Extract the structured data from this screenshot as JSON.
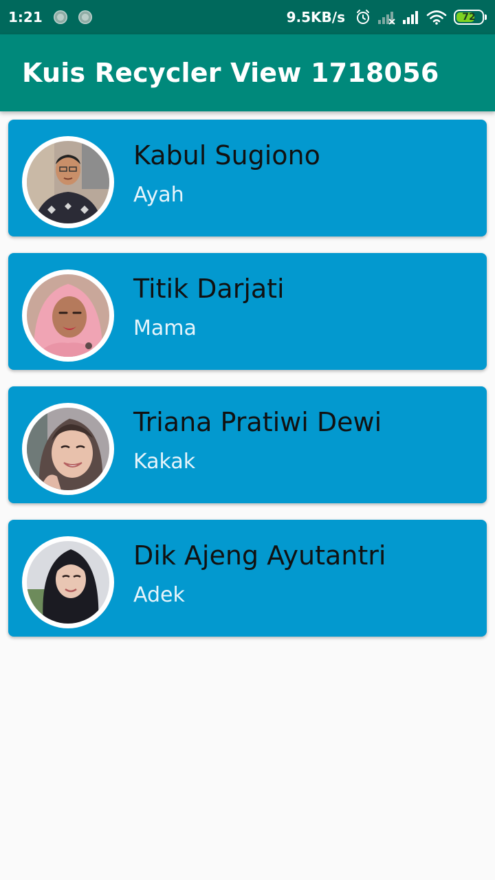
{
  "status_bar": {
    "time": "1:21",
    "net_speed": "9.5KB/s",
    "battery_level": "72",
    "battery_fraction": 0.72,
    "icons": [
      "notification-dot-icon",
      "notification-dot-icon",
      "alarm-icon",
      "signal-icon",
      "signal-icon",
      "wifi-icon",
      "battery-icon"
    ]
  },
  "app_bar": {
    "title": "Kuis Recycler View 1718056"
  },
  "contacts": [
    {
      "name": "Kabul Sugiono",
      "role": "Ayah"
    },
    {
      "name": "Titik Darjati",
      "role": "Mama"
    },
    {
      "name": "Triana Pratiwi Dewi",
      "role": "Kakak"
    },
    {
      "name": "Dik Ajeng Ayutantri",
      "role": "Adek"
    }
  ],
  "colors": {
    "status_bar": "#00695c",
    "app_bar": "#00897b",
    "card": "#0399cf",
    "background": "#fafafa",
    "battery": "#7ed321"
  }
}
